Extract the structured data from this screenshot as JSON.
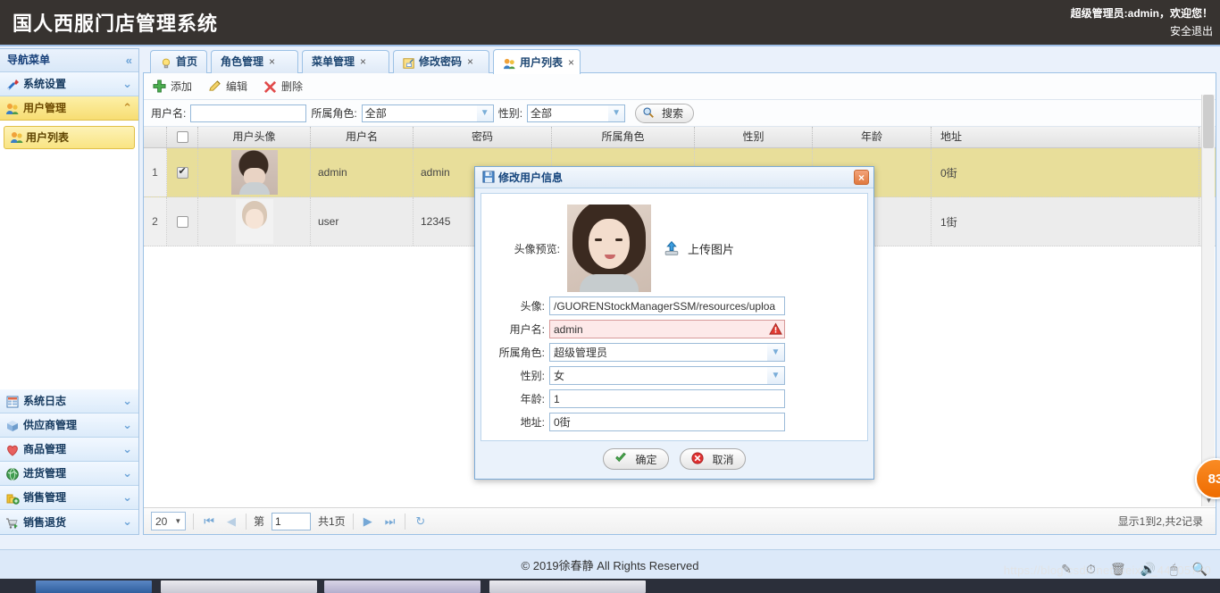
{
  "header": {
    "system_title": "国人西服门店管理系统",
    "welcome": "超级管理员:admin，欢迎您！",
    "logout": "安全退出"
  },
  "sidebar": {
    "title": "导航菜单",
    "collapse_icon": "chevron-double-left-icon",
    "items": [
      {
        "label": "系统设置",
        "icon": "tools-icon",
        "expanded": false
      },
      {
        "label": "用户管理",
        "icon": "users-icon",
        "expanded": true
      }
    ],
    "sub_items": [
      {
        "label": "用户列表",
        "icon": "users-icon",
        "active": true
      }
    ],
    "bottom_items": [
      {
        "label": "系统日志",
        "icon": "log-icon"
      },
      {
        "label": "供应商管理",
        "icon": "box-icon"
      },
      {
        "label": "商品管理",
        "icon": "heart-icon"
      },
      {
        "label": "进货管理",
        "icon": "globe-icon"
      },
      {
        "label": "销售管理",
        "icon": "money-icon"
      },
      {
        "label": "销售退货",
        "icon": "cart-icon"
      }
    ]
  },
  "tabs": [
    {
      "label": "首页",
      "icon": "bulb-icon",
      "closable": false,
      "selected": false
    },
    {
      "label": "角色管理",
      "icon": "",
      "closable": true,
      "selected": false
    },
    {
      "label": "菜单管理",
      "icon": "",
      "closable": true,
      "selected": false
    },
    {
      "label": "修改密码",
      "icon": "key-icon",
      "closable": true,
      "selected": false
    },
    {
      "label": "用户列表",
      "icon": "users-icon",
      "closable": true,
      "selected": true
    }
  ],
  "toolbar": {
    "add_label": "添加",
    "edit_label": "编辑",
    "delete_label": "删除"
  },
  "search": {
    "username_label": "用户名:",
    "username_value": "",
    "role_label": "所属角色:",
    "role_value": "全部",
    "gender_label": "性别:",
    "gender_value": "全部",
    "search_button": "搜索"
  },
  "grid": {
    "columns": [
      "",
      "",
      "用户头像",
      "用户名",
      "密码",
      "所属角色",
      "性别",
      "年龄",
      "地址"
    ],
    "rows": [
      {
        "index": "1",
        "checked": true,
        "avatar": "female-photo-avatar",
        "username": "admin",
        "password": "admin",
        "role": "",
        "gender": "",
        "age": "",
        "address": "0街"
      },
      {
        "index": "2",
        "checked": false,
        "avatar": "anime-avatar",
        "username": "user",
        "password": "12345",
        "role": "",
        "gender": "",
        "age": "",
        "address": "1街"
      }
    ]
  },
  "pager": {
    "page_size": "20",
    "first_icon": "first-page-icon",
    "prev_icon": "prev-page-icon",
    "page_prefix": "第",
    "page_number": "1",
    "page_suffix": "共1页",
    "next_icon": "next-page-icon",
    "last_icon": "last-page-icon",
    "refresh_icon": "refresh-icon",
    "info": "显示1到2,共2记录"
  },
  "dialog": {
    "title": "修改用户信息",
    "title_icon": "save-icon",
    "close_icon": "close-icon",
    "preview_label": "头像预览:",
    "upload_label": "上传图片",
    "upload_icon": "upload-icon",
    "fields": [
      {
        "label": "头像:",
        "value": "/GUORENStockManagerSSM/resources/uploa",
        "type": "text"
      },
      {
        "label": "用户名:",
        "value": "admin",
        "type": "text-error"
      },
      {
        "label": "所属角色:",
        "value": "超级管理员",
        "type": "select"
      },
      {
        "label": "性别:",
        "value": "女",
        "type": "select"
      },
      {
        "label": "年龄:",
        "value": "1",
        "type": "text"
      },
      {
        "label": "地址:",
        "value": "0街",
        "type": "text"
      }
    ],
    "ok_label": "确定",
    "cancel_label": "取消"
  },
  "footer": {
    "copyright": "© 2019徐春静 All Rights Reserved"
  },
  "overlay": {
    "watermark": "https://blog.csdn.net/weixin_44705730",
    "badge_value": "83"
  }
}
